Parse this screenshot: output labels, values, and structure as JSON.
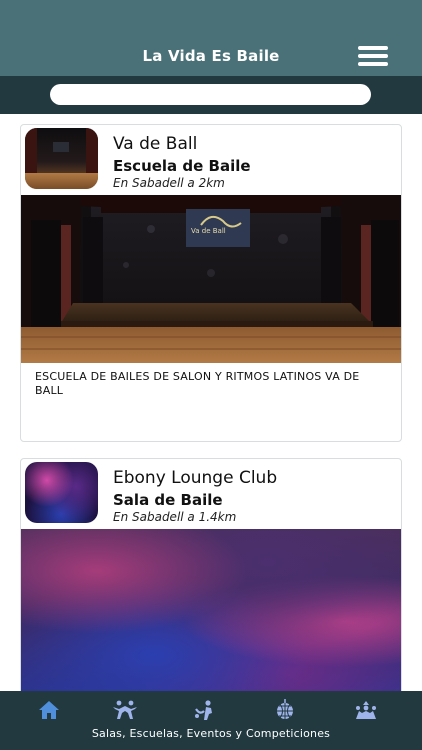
{
  "app": {
    "title": "La Vida Es Baile"
  },
  "search": {
    "value": "",
    "placeholder": ""
  },
  "cards": [
    {
      "name": "Va de Ball",
      "type": "Escuela de Baile",
      "distance": "En Sabadell a 2km",
      "description": "ESCUELA DE BAILES DE SALON Y RITMOS LATINOS VA DE BALL",
      "image_icon": "stage-photo"
    },
    {
      "name": "Ebony Lounge Club",
      "type": "Sala de Baile",
      "distance": "En Sabadell a 1.4km",
      "description": "",
      "image_icon": "club-photo"
    }
  ],
  "bottom_nav": {
    "caption": "Salas, Escuelas, Eventos y Competiciones",
    "tabs": [
      {
        "icon": "home-icon",
        "active": true
      },
      {
        "icon": "dancers-icon",
        "active": false
      },
      {
        "icon": "couple-dance-icon",
        "active": false
      },
      {
        "icon": "disco-ball-icon",
        "active": false
      },
      {
        "icon": "party-icon",
        "active": false
      }
    ]
  },
  "colors": {
    "header": "#4a7178",
    "search_bar": "#21393f",
    "bottom_nav": "#21393f",
    "active_tab": "#4f8fdc",
    "inactive_tab": "#9fb4ea"
  }
}
